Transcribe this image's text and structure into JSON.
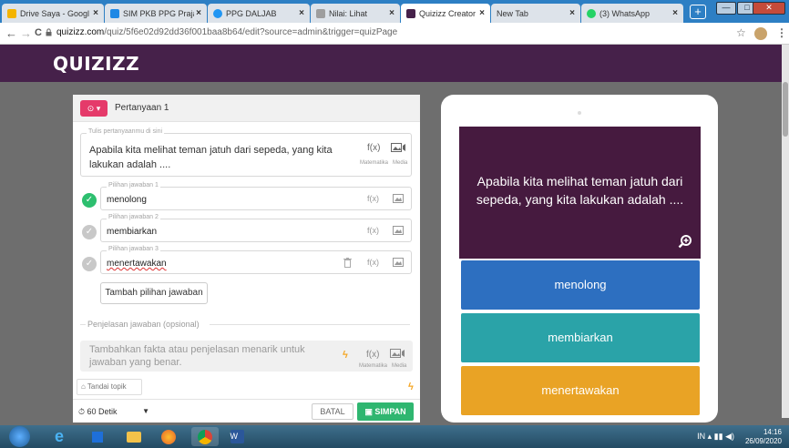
{
  "browser": {
    "tabs": [
      {
        "title": "Drive Saya - Googl",
        "favicon_color": "#f4b400",
        "active": false
      },
      {
        "title": "SIM PKB PPG Praja",
        "favicon_color": "#1e88e5",
        "active": false
      },
      {
        "title": "PPG DALJAB",
        "favicon_color": "#2196f3",
        "active": false
      },
      {
        "title": "Nilai: Lihat",
        "favicon_color": "#9e9e9e",
        "active": false
      },
      {
        "title": "Quizizz Creator",
        "favicon_color": "#46214a",
        "active": true
      },
      {
        "title": "New Tab",
        "favicon_color": "#ffffff",
        "active": false
      },
      {
        "title": "(3) WhatsApp",
        "favicon_color": "#25d366",
        "active": false
      }
    ],
    "new_tab_label": "+",
    "url_host": "quizizz.com",
    "url_path": "/quiz/5f6e02d92dd36f001baa8b64/edit?source=admin&trigger=quizPage",
    "nav_back": "←",
    "nav_forward": "→",
    "nav_reload": "C",
    "window_min": "—",
    "window_max": "□",
    "window_close": "✕"
  },
  "app": {
    "logo": "QUIZIZZ",
    "brand_color": "#46214a"
  },
  "editor": {
    "question_type_icon": "⊙ ▾",
    "question_label": "Pertanyaan 1",
    "question_field_label": "Tulis pertanyaanmu di sini",
    "question_text": "Apabila kita melihat teman jatuh dari sepeda, yang kita lakukan adalah ....",
    "math_tool": "f(x)",
    "math_caption": "Matematika",
    "media_caption": "Media",
    "answers": [
      {
        "label": "Pilihan jawaban 1",
        "text": "menolong",
        "correct": true
      },
      {
        "label": "Pilihan jawaban 2",
        "text": "membiarkan",
        "correct": false
      },
      {
        "label": "Pilihan jawaban 3",
        "text": "menertawakan",
        "correct": false
      }
    ],
    "add_answer_label": "Tambah pilihan jawaban",
    "explanation_header": "Penjelasan jawaban (opsional)",
    "explanation_placeholder": "Tambahkan fakta atau penjelasan menarik untuk jawaban yang benar.",
    "topic_label": "Tandai topik",
    "timer_value": "⏱ 60 Detik",
    "cancel_label": "BATAL",
    "save_label": "SIMPAN",
    "accent_color": "#2fb670"
  },
  "preview": {
    "question_text": "Apabila kita melihat teman jatuh dari sepeda, yang kita lakukan adalah ....",
    "options": [
      {
        "text": "menolong",
        "color": "#2d6fc0"
      },
      {
        "text": "membiarkan",
        "color": "#2aa3a8"
      },
      {
        "text": "menertawakan",
        "color": "#e9a325"
      }
    ]
  },
  "taskbar": {
    "language": "IN",
    "time": "14:16",
    "date": "26/09/2020"
  }
}
